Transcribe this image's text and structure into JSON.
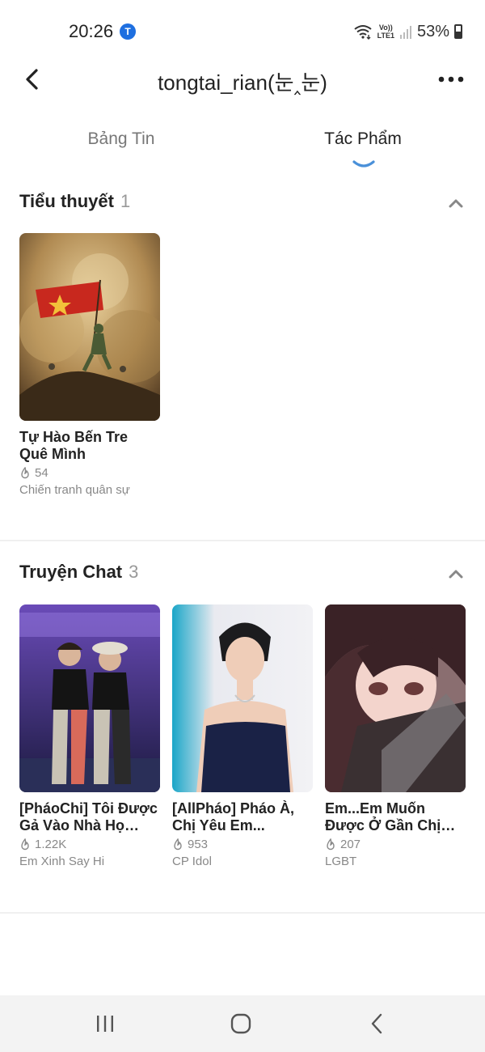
{
  "status": {
    "time": "20:26",
    "app_badge": "T",
    "lte_top": "Vo))",
    "lte_bottom": "LTE1",
    "battery": "53%"
  },
  "header": {
    "title": "tongtai_rian(눈‸눈)"
  },
  "tabs": [
    {
      "label": "Bảng Tin",
      "active": false
    },
    {
      "label": "Tác Phẩm",
      "active": true
    }
  ],
  "sections": [
    {
      "title": "Tiểu thuyết",
      "count": "1",
      "items": [
        {
          "title": "Tự Hào Bến Tre Quê Mình",
          "views": "54",
          "genre": "Chiến tranh quân sự"
        }
      ]
    },
    {
      "title": "Truyện Chat",
      "count": "3",
      "items": [
        {
          "title": "[PháoChi] Tôi Được Gả Vào Nhà Họ Ng...",
          "views": "1.22K",
          "genre": "Em Xinh Say Hi"
        },
        {
          "title": "[AllPháo] Pháo À, Chị Yêu Em...",
          "views": "953",
          "genre": "CP Idol"
        },
        {
          "title": "Em...Em Muốn Được Ở Gần Chị Hơn",
          "views": "207",
          "genre": "LGBT"
        }
      ]
    }
  ],
  "colors": {
    "accent": "#4a90d9",
    "badge": "#1e6fe0"
  }
}
